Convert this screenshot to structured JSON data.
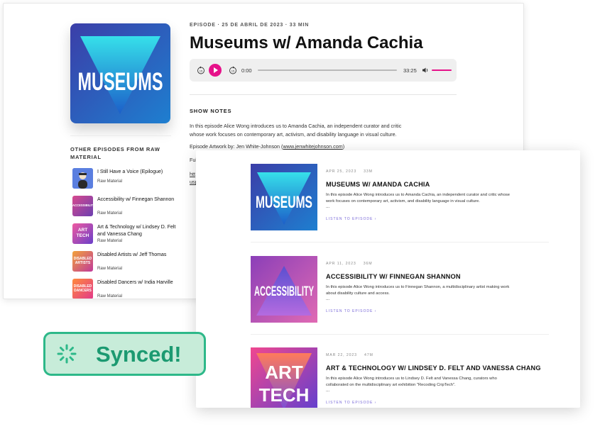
{
  "episode_page": {
    "meta": "EPISODE · 25 DE ABRIL DE 2023 · 33 MIN",
    "title": "Museums w/ Amanda Cachia",
    "cover_text": "MUSEUMS",
    "player": {
      "current_time": "0:00",
      "duration": "33:25",
      "skip_back_label": "15",
      "skip_forward_label": "15",
      "accent_color": "#e6128a"
    },
    "show_notes_heading": "SHOW NOTES",
    "show_notes_text": "In this episode Alice Wong introduces us to Amanda Cachia, an independent curator and critic whose work focuses on contemporary art, activism, and disability language in visual culture.",
    "artwork_prefix": "Episode Artwork by: Jen White-Johnson (",
    "artwork_link": "www.jenwhitejohnson.com",
    "artwork_suffix": ")",
    "cut_line_1": "Ful",
    "cut_line_2": "htt",
    "cut_line_3": "usp"
  },
  "other_episodes": {
    "heading": "OTHER EPISODES FROM RAW MATERIAL",
    "items": [
      {
        "title": "I Still Have a Voice (Epilogue)",
        "show": "Raw Material",
        "thumb_text": ""
      },
      {
        "title": "Accessibility w/ Finnegan Shannon",
        "show": "Raw Material",
        "thumb_text": "ACCESSIBILITY"
      },
      {
        "title": "Art & Technology w/ Lindsey D. Felt and Vanessa Chang",
        "show": "Raw Material",
        "thumb_text": "ART TECH"
      },
      {
        "title": "Disabled Artists w/ Jeff Thomas",
        "show": "Raw Material",
        "thumb_text": "DISABLED ARTISTS"
      },
      {
        "title": "Disabled Dancers w/ India Harville",
        "show": "Raw Material",
        "thumb_text": "DISABLED DANCERS"
      }
    ]
  },
  "episode_list": {
    "listen_label": "LISTEN TO EPISODE ›",
    "more": "...",
    "items": [
      {
        "date": "APR 25, 2023",
        "duration": "33M",
        "title": "MUSEUMS W/ AMANDA CACHIA",
        "description": "In this episode Alice Wong introduces us to Amanda Cachia, an independent curator and critic whose work focuses on contemporary art, activism, and disability language in visual culture.",
        "art_text": "MUSEUMS"
      },
      {
        "date": "APR 11, 2023",
        "duration": "36M",
        "title": "ACCESSIBILITY W/ FINNEGAN SHANNON",
        "description": "In this episode Alice Wong introduces us to Finnegan Shannon, a multidisciplinary artist making work about disability culture and access.",
        "art_text": "ACCESSIBILITY"
      },
      {
        "date": "MAR 22, 2023",
        "duration": "47M",
        "title": "ART & TECHNOLOGY W/ LINDSEY D. FELT AND VANESSA CHANG",
        "description": "In this episode Alice Wong introduces us to Lindsey D. Felt and Vanessa Chang, curators who collaborated on the multidisciplinary art exhibition \"Recoding CripTech\".",
        "art_text_line1": "ART",
        "art_text_line2": "TECH"
      }
    ]
  },
  "synced_badge": {
    "label": "Synced!",
    "color": "#1c9a71",
    "background": "#c7ecd9"
  }
}
